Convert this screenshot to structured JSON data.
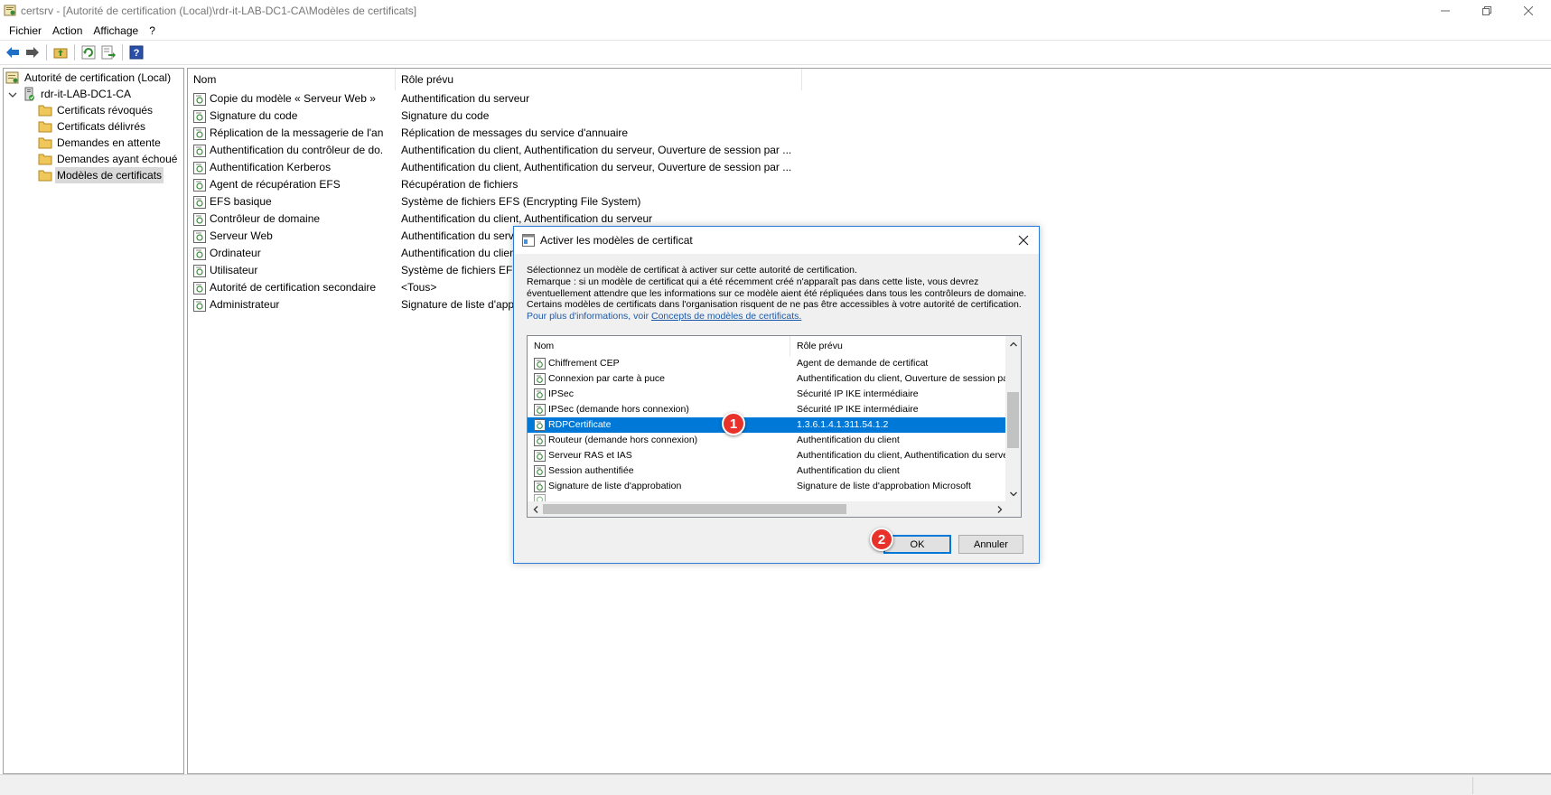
{
  "window": {
    "title": "certsrv - [Autorité de certification (Local)\\rdr-it-LAB-DC1-CA\\Modèles de certificats]"
  },
  "menu": [
    "Fichier",
    "Action",
    "Affichage",
    "?"
  ],
  "tree": {
    "root": "Autorité de certification (Local)",
    "ca": "rdr-it-LAB-DC1-CA",
    "folders": [
      "Certificats révoqués",
      "Certificats délivrés",
      "Demandes en attente",
      "Demandes ayant échoué",
      "Modèles de certificats"
    ]
  },
  "list": {
    "columns": [
      "Nom",
      "Rôle prévu"
    ],
    "rows": [
      {
        "name": "Copie du modèle « Serveur Web »",
        "role": "Authentification du serveur"
      },
      {
        "name": "Signature du code",
        "role": "Signature du code"
      },
      {
        "name": "Réplication de la messagerie de l'ann...",
        "role": "Réplication de messages du service d'annuaire"
      },
      {
        "name": "Authentification du contrôleur de do...",
        "role": "Authentification du client, Authentification du serveur, Ouverture de session par ..."
      },
      {
        "name": "Authentification Kerberos",
        "role": "Authentification du client, Authentification du serveur, Ouverture de session par ..."
      },
      {
        "name": "Agent de récupération EFS",
        "role": "Récupération de fichiers"
      },
      {
        "name": "EFS basique",
        "role": "Système de fichiers EFS (Encrypting File System)"
      },
      {
        "name": "Contrôleur de domaine",
        "role": "Authentification du client, Authentification du serveur"
      },
      {
        "name": "Serveur Web",
        "role": "Authentification du serveur"
      },
      {
        "name": "Ordinateur",
        "role": "Authentification du client, Authentification du serveur"
      },
      {
        "name": "Utilisateur",
        "role": "Système de fichiers EFS (Encrypting File System)"
      },
      {
        "name": "Autorité de certification secondaire",
        "role": "<Tous>"
      },
      {
        "name": "Administrateur",
        "role": "Signature de liste d'approbation Microsoft"
      }
    ]
  },
  "dialog": {
    "title": "Activer les modèles de certificat",
    "lines": [
      "Sélectionnez un modèle de certificat à activer sur cette autorité de certification.",
      "Remarque : si un modèle de certificat qui a été récemment créé n'apparaît pas dans cette liste, vous devrez",
      "éventuellement attendre que les informations sur ce modèle aient été répliquées dans tous les contrôleurs de domaine.",
      "Certains modèles de certificats dans l'organisation risquent de ne pas être accessibles à votre autorité de certification."
    ],
    "more_info": "Pour plus d'informations, voir ",
    "more_info_link": "Concepts de modèles de certificats.",
    "columns": [
      "Nom",
      "Rôle prévu"
    ],
    "rows": [
      {
        "name": "Chiffrement CEP",
        "role": "Agent de demande de certificat"
      },
      {
        "name": "Connexion par carte à puce",
        "role": "Authentification du client, Ouverture de session par carte à puce"
      },
      {
        "name": "IPSec",
        "role": "Sécurité IP IKE intermédiaire"
      },
      {
        "name": "IPSec (demande hors connexion)",
        "role": "Sécurité IP IKE intermédiaire"
      },
      {
        "name": "RDPCertificate",
        "role": "1.3.6.1.4.1.311.54.1.2"
      },
      {
        "name": "Routeur (demande hors connexion)",
        "role": "Authentification du client"
      },
      {
        "name": "Serveur RAS et IAS",
        "role": "Authentification du client, Authentification du serveur"
      },
      {
        "name": "Session authentifiée",
        "role": "Authentification du client"
      },
      {
        "name": "Signature de liste d'approbation",
        "role": "Signature de liste d'approbation Microsoft"
      }
    ],
    "selected_index": 4,
    "ok_label": "OK",
    "cancel_label": "Annuler"
  },
  "badges": [
    "1",
    "2"
  ],
  "colors": {
    "selection": "#0078d7",
    "badge": "#e8312b",
    "link": "#1e5aa8"
  }
}
